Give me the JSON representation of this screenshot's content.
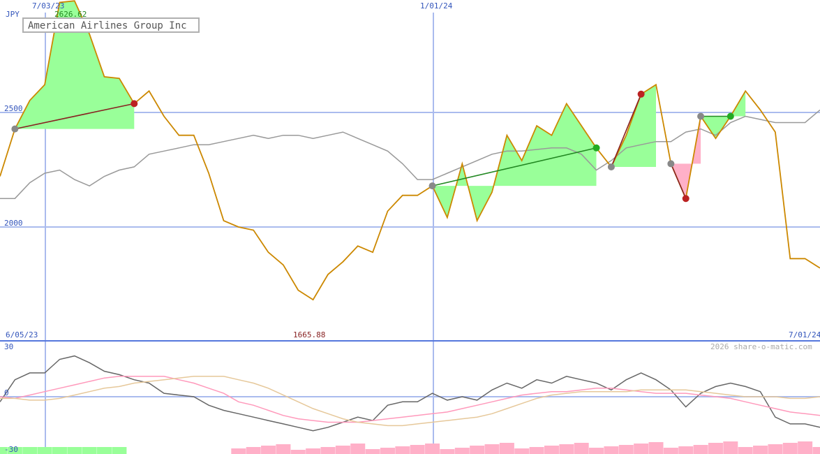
{
  "title": "American Airlines Group Inc",
  "currency": "JPY",
  "watermark": "2026 share-o-matic.com",
  "date_labels": {
    "top_left": "7/03/23",
    "top_mid": "1/01/24",
    "bottom_left": "6/05/23",
    "bottom_right": "7/01/24"
  },
  "price_axis": {
    "ticks": [
      "2500",
      "2000"
    ]
  },
  "osc_axis": {
    "ticks": [
      "30",
      "0",
      "-30"
    ]
  },
  "annotations": {
    "high": "2626.62",
    "low": "1665.88"
  },
  "colors": {
    "price_line": "#cc8800",
    "avg_line": "#999999",
    "up_fill": "#99ff99",
    "down_fill": "#ffb0c8",
    "up_trend": "#228822",
    "down_trend": "#882222",
    "grid": "#aabbee",
    "axis_text": "#3355bb",
    "osc_line": "#666666",
    "osc_pink": "#ff99bb",
    "osc_tan": "#e6c89a"
  },
  "chart_data": {
    "type": "line",
    "y_range": [
      1550,
      2610
    ],
    "osc_range": [
      -30,
      30
    ],
    "series": [
      {
        "values": [
          2070,
          2220,
          2310,
          2360,
          2620,
          2625,
          2520,
          2385,
          2380,
          2300,
          2340,
          2260,
          2200,
          2200,
          2080,
          1930,
          1910,
          1900,
          1830,
          1790,
          1710,
          1680,
          1760,
          1800,
          1850,
          1830,
          1960,
          2010,
          2010,
          2040,
          1940,
          2110,
          1930,
          2020,
          2200,
          2120,
          2230,
          2200,
          2300,
          2230,
          2160,
          2100,
          2200,
          2330,
          2360,
          2110,
          2000,
          2260,
          2190,
          2260,
          2340,
          2280,
          2210,
          1810,
          1810,
          1780
        ]
      },
      {
        "values": [
          2000,
          2000,
          2050,
          2080,
          2090,
          2060,
          2040,
          2070,
          2090,
          2100,
          2140,
          2150,
          2160,
          2170,
          2170,
          2180,
          2190,
          2200,
          2190,
          2200,
          2200,
          2190,
          2200,
          2210,
          2190,
          2170,
          2150,
          2110,
          2060,
          2060,
          2080,
          2100,
          2120,
          2140,
          2150,
          2150,
          2155,
          2160,
          2160,
          2140,
          2090,
          2120,
          2160,
          2170,
          2180,
          2180,
          2210,
          2220,
          2200,
          2240,
          2260,
          2250,
          2240,
          2240,
          2240,
          2280
        ]
      }
    ],
    "oscillator": [
      {
        "values": [
          -3,
          10,
          14,
          14,
          22,
          24,
          20,
          15,
          13,
          10,
          8,
          2,
          1,
          0,
          -5,
          -8,
          -10,
          -12,
          -14,
          -16,
          -18,
          -20,
          -18,
          -15,
          -12,
          -14,
          -5,
          -3,
          -3,
          2,
          -2,
          0,
          -2,
          4,
          8,
          5,
          10,
          8,
          12,
          10,
          8,
          4,
          10,
          14,
          10,
          4,
          -6,
          2,
          6,
          8,
          6,
          3,
          -12,
          -16,
          -16,
          -18
        ]
      },
      {
        "values": [
          0,
          -1,
          1,
          3,
          5,
          7,
          9,
          11,
          12,
          12,
          12,
          12,
          10,
          8,
          5,
          2,
          -3,
          -5,
          -8,
          -11,
          -13,
          -14,
          -15,
          -15,
          -15,
          -14,
          -13,
          -12,
          -11,
          -10,
          -9,
          -7,
          -5,
          -3,
          -1,
          1,
          2,
          3,
          3,
          4,
          5,
          5,
          4,
          3,
          2,
          2,
          2,
          1,
          0,
          -1,
          -3,
          -5,
          -7,
          -9,
          -10,
          -11
        ]
      },
      {
        "values": [
          -1,
          -1,
          -2,
          -2,
          -1,
          1,
          3,
          5,
          6,
          8,
          9,
          10,
          11,
          12,
          12,
          12,
          10,
          8,
          5,
          1,
          -3,
          -7,
          -10,
          -13,
          -15,
          -16,
          -17,
          -17,
          -16,
          -15,
          -14,
          -13,
          -12,
          -10,
          -7,
          -4,
          -1,
          1,
          2,
          3,
          3,
          3,
          3,
          4,
          4,
          4,
          4,
          3,
          2,
          1,
          0,
          0,
          0,
          -1,
          -1,
          0
        ]
      }
    ]
  }
}
